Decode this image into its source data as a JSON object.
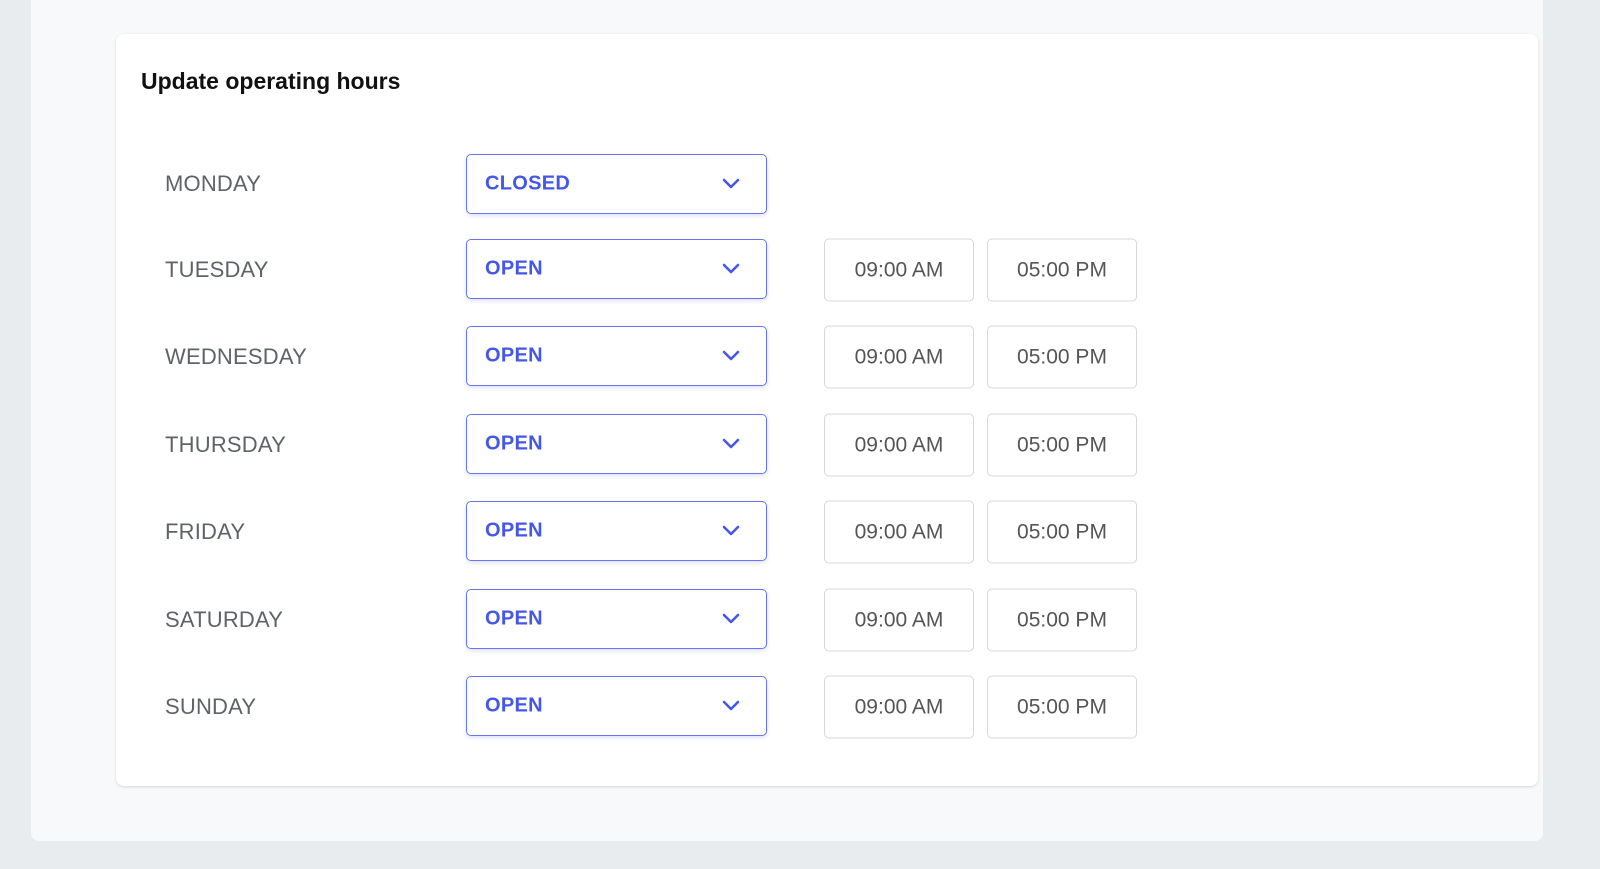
{
  "form": {
    "title": "Update operating hours",
    "days": [
      {
        "day": "MONDAY",
        "status": "CLOSED",
        "open_time": "",
        "close_time": ""
      },
      {
        "day": "TUESDAY",
        "status": "OPEN",
        "open_time": "09:00 AM",
        "close_time": "05:00 PM"
      },
      {
        "day": "WEDNESDAY",
        "status": "OPEN",
        "open_time": "09:00 AM",
        "close_time": "05:00 PM"
      },
      {
        "day": "THURSDAY",
        "status": "OPEN",
        "open_time": "09:00 AM",
        "close_time": "05:00 PM"
      },
      {
        "day": "FRIDAY",
        "status": "OPEN",
        "open_time": "09:00 AM",
        "close_time": "05:00 PM"
      },
      {
        "day": "SATURDAY",
        "status": "OPEN",
        "open_time": "09:00 AM",
        "close_time": "05:00 PM"
      },
      {
        "day": "SUNDAY",
        "status": "OPEN",
        "open_time": "09:00 AM",
        "close_time": "05:00 PM"
      }
    ]
  },
  "icons": {
    "dropdown": "chevron-down-icon"
  },
  "colors": {
    "accent": "#4557e8",
    "select_border": "#6776f0",
    "page_background": "#e8ecef"
  }
}
